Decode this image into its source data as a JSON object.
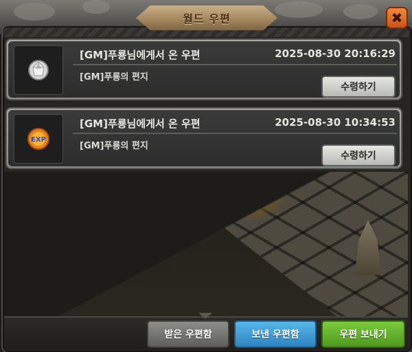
{
  "window": {
    "title": "월드 우편"
  },
  "close_button": {
    "icon": "close-icon",
    "symbol": "✖",
    "color": "#e06a28"
  },
  "mails": [
    {
      "item_icon": "silver-gem-icon",
      "sender": "[GM]푸룡님에게서 온 우편",
      "date": "2025-08-30 20:16:29",
      "body": "[GM]푸룡의 편지",
      "claim_label": "수령하기"
    },
    {
      "item_icon": "exp-orb-icon",
      "icon_text": "EXP",
      "sender": "[GM]푸룡님에게서 온 우편",
      "date": "2025-08-30 10:34:53",
      "body": "[GM]푸룡의 편지",
      "claim_label": "수령하기"
    }
  ],
  "bottom_tabs": {
    "received_label": "받은 우편함",
    "sent_label": "보낸 우편함",
    "send_label": "우편 보내기"
  },
  "colors": {
    "received_tab": "#7a7a76",
    "sent_tab": "#3f9fd6",
    "send_tab": "#66b530"
  }
}
